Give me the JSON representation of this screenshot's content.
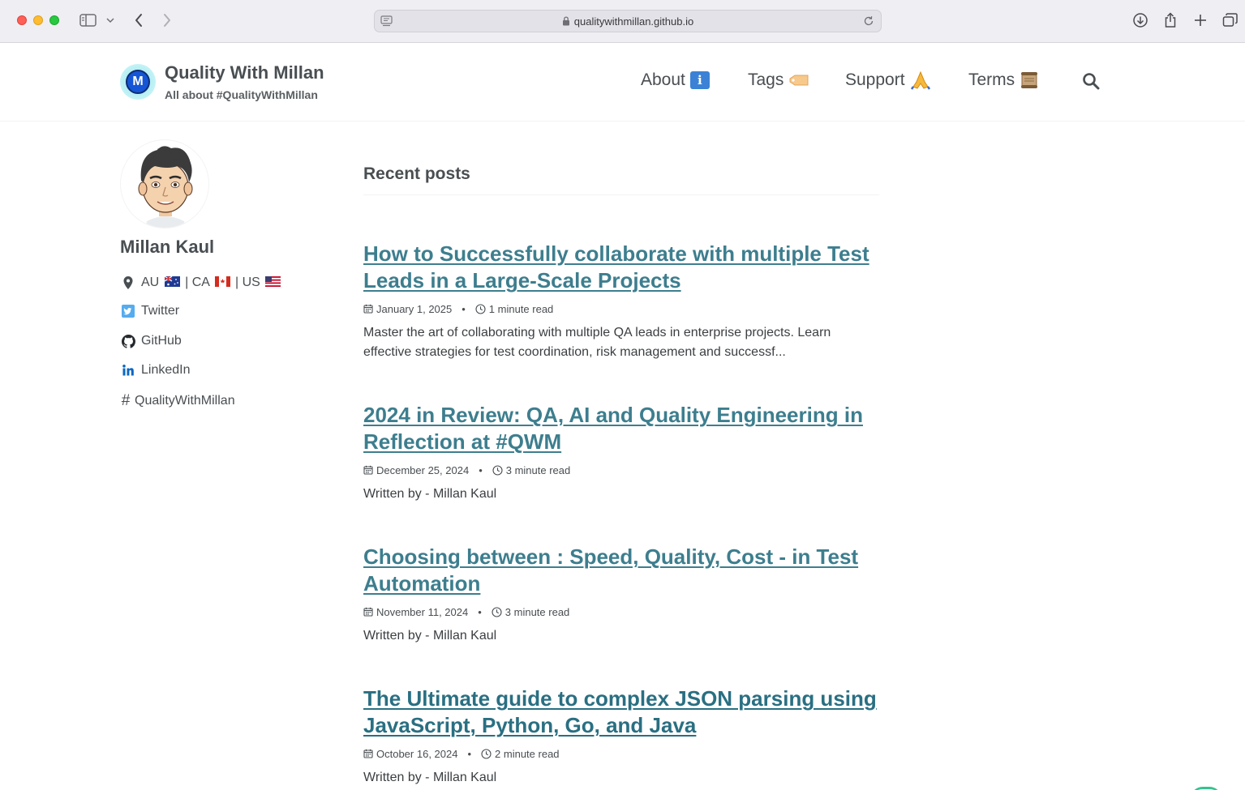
{
  "browser": {
    "url": "qualitywithmillan.github.io",
    "icons": [
      "sidebar-icon",
      "chevron-down-icon",
      "back-icon",
      "forward-icon",
      "reader-icon",
      "lock-icon",
      "reload-icon",
      "download-icon",
      "share-icon",
      "new-tab-icon",
      "tabs-overview-icon"
    ]
  },
  "site": {
    "logo_letter": "M",
    "title": "Quality With Millan",
    "subtitle": "All about #QualityWithMillan"
  },
  "nav": {
    "items": [
      {
        "label": "About",
        "icon": "info-emoji-icon"
      },
      {
        "label": "Tags",
        "icon": "label-tag-emoji-icon"
      },
      {
        "label": "Support",
        "icon": "folded-hands-emoji-icon"
      },
      {
        "label": "Terms",
        "icon": "scroll-emoji-icon"
      }
    ],
    "search_icon": "search-icon"
  },
  "author": {
    "name": "Millan Kaul",
    "location": {
      "au": "AU",
      "ca": "CA",
      "us": "US",
      "divider": "|"
    },
    "links": [
      {
        "label": "Twitter",
        "icon": "twitter-icon"
      },
      {
        "label": "GitHub",
        "icon": "github-icon"
      },
      {
        "label": "LinkedIn",
        "icon": "linkedin-icon"
      },
      {
        "label": "QualityWithMillan",
        "icon": "hashtag-icon"
      }
    ]
  },
  "main": {
    "heading": "Recent posts",
    "posts": [
      {
        "title": "How to Successfully collaborate with multiple Test Leads in a Large-Scale Projects",
        "date": "January 1, 2025",
        "read_time": "1 minute read",
        "excerpt": "Master the art of collaborating with multiple QA leads in enterprise projects. Learn effective strategies for test coordination, risk management and successf..."
      },
      {
        "title": "2024 in Review: QA, AI and Quality Engineering in Reflection at #QWM",
        "date": "December 25, 2024",
        "read_time": "3 minute read",
        "excerpt": "Written by - Millan Kaul"
      },
      {
        "title": "Choosing between : Speed, Quality, Cost - in Test Automation",
        "date": "November 11, 2024",
        "read_time": "3 minute read",
        "excerpt": "Written by - Millan Kaul"
      },
      {
        "title": "The Ultimate guide to complex JSON parsing using JavaScript, Python, Go, and Java",
        "date": "October 16, 2024",
        "read_time": "2 minute read",
        "excerpt": "Written by - Millan Kaul"
      }
    ]
  },
  "colors": {
    "link": "#3d7e8e",
    "text": "#494e52",
    "chrome": "#efeef3"
  }
}
